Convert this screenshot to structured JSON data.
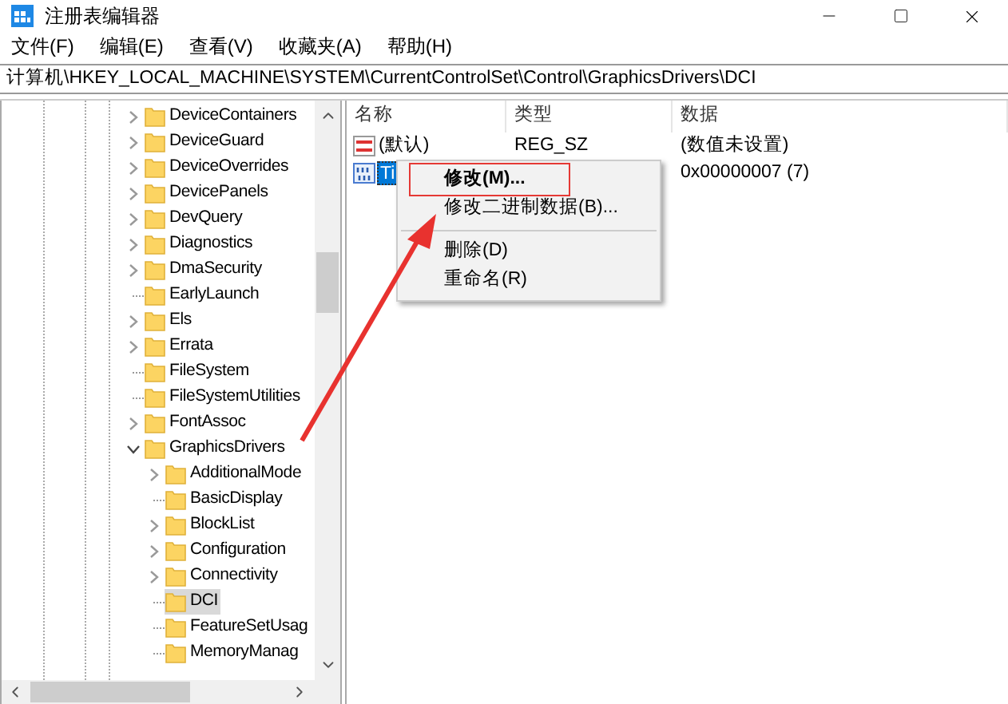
{
  "window": {
    "title": "注册表编辑器"
  },
  "menu": [
    "文件(F)",
    "编辑(E)",
    "查看(V)",
    "收藏夹(A)",
    "帮助(H)"
  ],
  "address": "计算机\\HKEY_LOCAL_MACHINE\\SYSTEM\\CurrentControlSet\\Control\\GraphicsDrivers\\DCI",
  "tree": [
    {
      "label": "DeviceContainers",
      "kind": "branch",
      "expanded": false,
      "selected": false
    },
    {
      "label": "DeviceGuard",
      "kind": "branch",
      "expanded": false,
      "selected": false
    },
    {
      "label": "DeviceOverrides",
      "kind": "branch",
      "expanded": false,
      "selected": false
    },
    {
      "label": "DevicePanels",
      "kind": "branch",
      "expanded": false,
      "selected": false
    },
    {
      "label": "DevQuery",
      "kind": "branch",
      "expanded": false,
      "selected": false
    },
    {
      "label": "Diagnostics",
      "kind": "branch",
      "expanded": false,
      "selected": false
    },
    {
      "label": "DmaSecurity",
      "kind": "branch",
      "expanded": false,
      "selected": false
    },
    {
      "label": "EarlyLaunch",
      "kind": "leaf",
      "selected": false
    },
    {
      "label": "Els",
      "kind": "branch",
      "expanded": false,
      "selected": false
    },
    {
      "label": "Errata",
      "kind": "branch",
      "expanded": false,
      "selected": false
    },
    {
      "label": "FileSystem",
      "kind": "leaf",
      "selected": false
    },
    {
      "label": "FileSystemUtilities",
      "kind": "leaf",
      "selected": false
    },
    {
      "label": "FontAssoc",
      "kind": "branch",
      "expanded": false,
      "selected": false
    },
    {
      "label": "GraphicsDrivers",
      "kind": "branch",
      "expanded": true,
      "selected": false,
      "children": [
        {
          "label": "AdditionalMode",
          "kind": "branch",
          "expanded": false,
          "selected": false
        },
        {
          "label": "BasicDisplay",
          "kind": "leaf",
          "selected": false
        },
        {
          "label": "BlockList",
          "kind": "branch",
          "expanded": false,
          "selected": false
        },
        {
          "label": "Configuration",
          "kind": "branch",
          "expanded": false,
          "selected": false
        },
        {
          "label": "Connectivity",
          "kind": "branch",
          "expanded": false,
          "selected": false
        },
        {
          "label": "DCI",
          "kind": "leaf",
          "selected": true
        },
        {
          "label": "FeatureSetUsag",
          "kind": "leaf",
          "selected": false
        },
        {
          "label": "MemoryManag",
          "kind": "leaf",
          "selected": false
        }
      ]
    }
  ],
  "values": {
    "columns": [
      "名称",
      "类型",
      "数据"
    ],
    "rows": [
      {
        "name": "(默认)",
        "type": "REG_SZ",
        "data": "(数值未设置)",
        "kind": "string",
        "selected": false
      },
      {
        "name": "Ti",
        "data": "0x00000007 (7)",
        "kind": "binary",
        "selected": true
      }
    ]
  },
  "context_menu": [
    {
      "label": "修改(M)...",
      "kind": "item",
      "bold": true,
      "highlighted": true
    },
    {
      "label": "修改二进制数据(B)...",
      "kind": "item",
      "bold": false,
      "highlighted": false
    },
    {
      "kind": "separator"
    },
    {
      "label": "删除(D)",
      "kind": "item",
      "bold": false,
      "highlighted": false
    },
    {
      "label": "重命名(R)",
      "kind": "item",
      "bold": false,
      "highlighted": false
    }
  ]
}
